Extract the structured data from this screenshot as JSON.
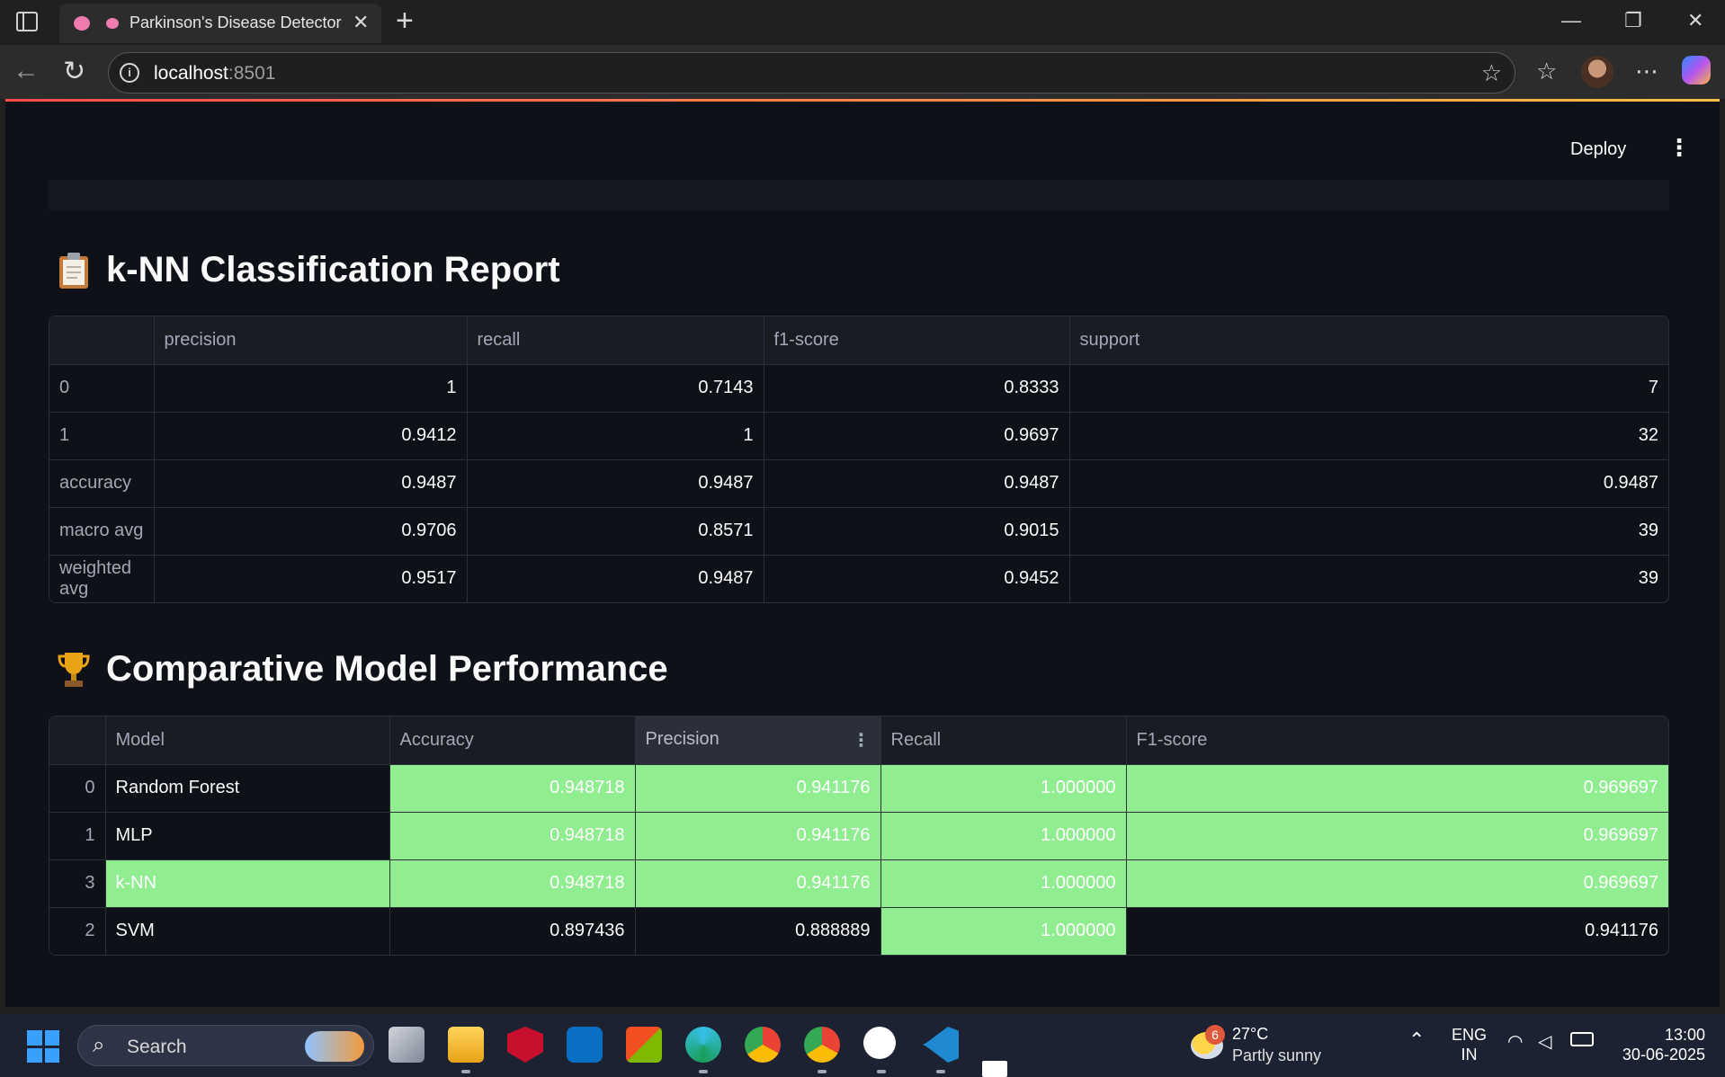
{
  "browser": {
    "tab_title": "Parkinson's Disease Detector",
    "url_host": "localhost",
    "url_port": ":8501"
  },
  "app": {
    "deploy_label": "Deploy"
  },
  "report": {
    "title": "k-NN Classification Report",
    "columns": [
      "",
      "precision",
      "recall",
      "f1-score",
      "support"
    ],
    "rows": [
      {
        "label": "0",
        "values": [
          "1",
          "0.7143",
          "0.8333",
          "7"
        ]
      },
      {
        "label": "1",
        "values": [
          "0.9412",
          "1",
          "0.9697",
          "32"
        ]
      },
      {
        "label": "accuracy",
        "values": [
          "0.9487",
          "0.9487",
          "0.9487",
          "0.9487"
        ]
      },
      {
        "label": "macro avg",
        "values": [
          "0.9706",
          "0.8571",
          "0.9015",
          "39"
        ]
      },
      {
        "label": "weighted avg",
        "values": [
          "0.9517",
          "0.9487",
          "0.9452",
          "39"
        ]
      }
    ]
  },
  "comparison": {
    "title": "Comparative Model Performance",
    "columns": [
      "",
      "Model",
      "Accuracy",
      "Precision",
      "Recall",
      "F1-score"
    ],
    "highlight_color": "#90ee90",
    "rows": [
      {
        "index": "0",
        "model": "Random Forest",
        "accuracy": "0.948718",
        "precision": "0.941176",
        "recall": "1.000000",
        "f1": "0.969697"
      },
      {
        "index": "1",
        "model": "MLP",
        "accuracy": "0.948718",
        "precision": "0.941176",
        "recall": "1.000000",
        "f1": "0.969697"
      },
      {
        "index": "3",
        "model": "k-NN",
        "accuracy": "0.948718",
        "precision": "0.941176",
        "recall": "1.000000",
        "f1": "0.969697"
      },
      {
        "index": "2",
        "model": "SVM",
        "accuracy": "0.897436",
        "precision": "0.888889",
        "recall": "1.000000",
        "f1": "0.941176"
      }
    ]
  },
  "taskbar": {
    "search_label": "Search",
    "weather_badge": "6",
    "weather_temp": "27°C",
    "weather_condition": "Partly sunny",
    "lang_line1": "ENG",
    "lang_line2": "IN",
    "time": "13:00",
    "date": "30-06-2025"
  }
}
